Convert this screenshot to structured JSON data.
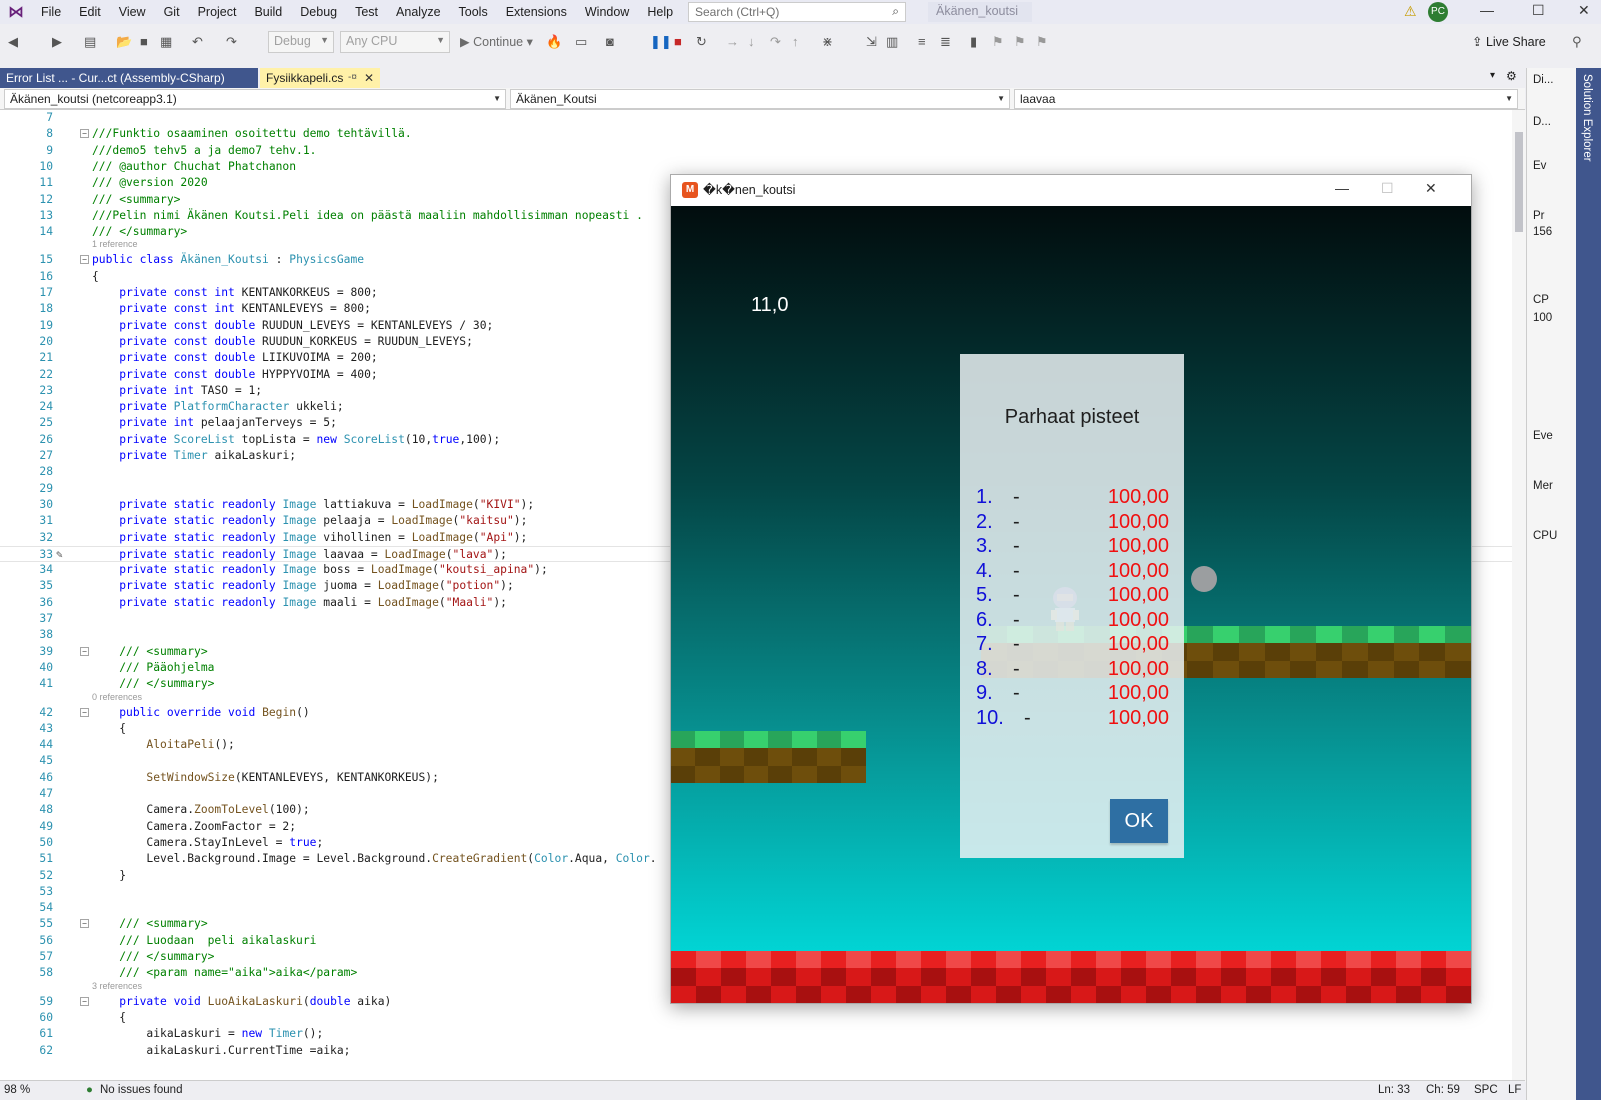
{
  "menubar": {
    "items": [
      "File",
      "Edit",
      "View",
      "Git",
      "Project",
      "Build",
      "Debug",
      "Test",
      "Analyze",
      "Tools",
      "Extensions",
      "Window",
      "Help"
    ],
    "search_placeholder": "Search (Ctrl+Q)",
    "solution_name": "Äkänen_koutsi",
    "avatar_initials": "PC"
  },
  "toolbar": {
    "config": "Debug",
    "platform": "Any CPU",
    "continue_label": "Continue",
    "live_share": "Live Share"
  },
  "tabs": {
    "error_list": "Error List ... - Cur...ct (Assembly-CSharp)",
    "file": "Fysiikkapeli.cs"
  },
  "navbar": {
    "project": "Äkänen_koutsi (netcoreapp3.1)",
    "class": "Äkänen_Koutsi",
    "member": "laavaa"
  },
  "code_lines": [
    {
      "n": "7",
      "html": ""
    },
    {
      "n": "8",
      "html": "<span class='cmt'>///Funktio osaaminen osoitettu demo tehtävillä.</span>",
      "fold": "−"
    },
    {
      "n": "9",
      "html": "<span class='cmt'>///demo5 tehv5 a ja demo7 tehv.1.</span>"
    },
    {
      "n": "10",
      "html": "<span class='cmt'>/// @author Chuchat Phatchanon</span>"
    },
    {
      "n": "11",
      "html": "<span class='cmt'>/// @version 2020</span>"
    },
    {
      "n": "12",
      "html": "<span class='cmt'>/// &lt;summary&gt;</span>"
    },
    {
      "n": "13",
      "html": "<span class='cmt'>///Pelin nimi Äkänen Koutsi.Peli idea on päästä maaliin mahdollisimman nopeasti .</span>"
    },
    {
      "n": "14",
      "html": "<span class='cmt'>/// &lt;/summary&gt;</span>",
      "ref": "1 reference"
    },
    {
      "n": "15",
      "html": "<span class='kw'>public class</span> <span class='ty'>Äkänen_Koutsi</span> : <span class='ty'>PhysicsGame</span>",
      "fold": "−"
    },
    {
      "n": "16",
      "html": "{"
    },
    {
      "n": "17",
      "html": "    <span class='kw'>private const int</span> KENTANKORKEUS = 800;"
    },
    {
      "n": "18",
      "html": "    <span class='kw'>private const int</span> KENTANLEVEYS = 800;"
    },
    {
      "n": "19",
      "html": "    <span class='kw'>private const double</span> RUUDUN_LEVEYS = KENTANLEVEYS / 30;"
    },
    {
      "n": "20",
      "html": "    <span class='kw'>private const double</span> RUUDUN_KORKEUS = RUUDUN_LEVEYS;"
    },
    {
      "n": "21",
      "html": "    <span class='kw'>private const double</span> LIIKUVOIMA = 200;"
    },
    {
      "n": "22",
      "html": "    <span class='kw'>private const double</span> HYPPYVOIMA = 400;"
    },
    {
      "n": "23",
      "html": "    <span class='kw'>private int</span> TASO = 1;"
    },
    {
      "n": "24",
      "html": "    <span class='kw'>private</span> <span class='ty'>PlatformCharacter</span> ukkeli;"
    },
    {
      "n": "25",
      "html": "    <span class='kw'>private int</span> pelaajanTerveys = 5;"
    },
    {
      "n": "26",
      "html": "    <span class='kw'>private</span> <span class='ty'>ScoreList</span> topLista = <span class='kw'>new</span> <span class='ty'>ScoreList</span>(10,<span class='kw'>true</span>,100);"
    },
    {
      "n": "27",
      "html": "    <span class='kw'>private</span> <span class='ty'>Timer</span> aikaLaskuri;"
    },
    {
      "n": "28",
      "html": ""
    },
    {
      "n": "29",
      "html": ""
    },
    {
      "n": "30",
      "html": "    <span class='kw'>private static readonly</span> <span class='ty'>Image</span> lattiakuva = <span class='mth'>LoadImage</span>(<span class='str'>\"KIVI\"</span>);"
    },
    {
      "n": "31",
      "html": "    <span class='kw'>private static readonly</span> <span class='ty'>Image</span> pelaaja = <span class='mth'>LoadImage</span>(<span class='str'>\"kaitsu\"</span>);"
    },
    {
      "n": "32",
      "html": "    <span class='kw'>private static readonly</span> <span class='ty'>Image</span> vihollinen = <span class='mth'>LoadImage</span>(<span class='str'>\"Api\"</span>);"
    },
    {
      "n": "33",
      "html": "    <span class='kw'>private static readonly</span> <span class='ty'>Image</span> laavaa = <span class='mth'>LoadImage</span>(<span class='str'>\"lava\"</span>);",
      "current": true
    },
    {
      "n": "34",
      "html": "    <span class='kw'>private static readonly</span> <span class='ty'>Image</span> boss = <span class='mth'>LoadImage</span>(<span class='str'>\"koutsi_apina\"</span>);"
    },
    {
      "n": "35",
      "html": "    <span class='kw'>private static readonly</span> <span class='ty'>Image</span> juoma = <span class='mth'>LoadImage</span>(<span class='str'>\"potion\"</span>);"
    },
    {
      "n": "36",
      "html": "    <span class='kw'>private static readonly</span> <span class='ty'>Image</span> maali = <span class='mth'>LoadImage</span>(<span class='str'>\"Maali\"</span>);"
    },
    {
      "n": "37",
      "html": ""
    },
    {
      "n": "38",
      "html": ""
    },
    {
      "n": "39",
      "html": "    <span class='cmt'>/// &lt;summary&gt;</span>",
      "fold": "−"
    },
    {
      "n": "40",
      "html": "    <span class='cmt'>/// Pääohjelma</span>"
    },
    {
      "n": "41",
      "html": "    <span class='cmt'>/// &lt;/summary&gt;</span>",
      "ref": "0 references"
    },
    {
      "n": "42",
      "html": "    <span class='kw'>public override void</span> <span class='mth'>Begin</span>()",
      "fold": "−"
    },
    {
      "n": "43",
      "html": "    {"
    },
    {
      "n": "44",
      "html": "        <span class='mth'>AloitaPeli</span>();"
    },
    {
      "n": "45",
      "html": ""
    },
    {
      "n": "46",
      "html": "        <span class='mth'>SetWindowSize</span>(KENTANLEVEYS, KENTANKORKEUS);"
    },
    {
      "n": "47",
      "html": ""
    },
    {
      "n": "48",
      "html": "        Camera.<span class='mth'>ZoomToLevel</span>(100);"
    },
    {
      "n": "49",
      "html": "        Camera.ZoomFactor = 2;"
    },
    {
      "n": "50",
      "html": "        Camera.StayInLevel = <span class='kw'>true</span>;"
    },
    {
      "n": "51",
      "html": "        Level.Background.Image = Level.Background.<span class='mth'>CreateGradient</span>(<span class='ty'>Color</span>.Aqua, <span class='ty'>Color</span>."
    },
    {
      "n": "52",
      "html": "    }"
    },
    {
      "n": "53",
      "html": ""
    },
    {
      "n": "54",
      "html": ""
    },
    {
      "n": "55",
      "html": "    <span class='cmt'>/// &lt;summary&gt;</span>",
      "fold": "−"
    },
    {
      "n": "56",
      "html": "    <span class='cmt'>/// Luodaan  peli aikalaskuri</span>"
    },
    {
      "n": "57",
      "html": "    <span class='cmt'>/// &lt;/summary&gt;</span>"
    },
    {
      "n": "58",
      "html": "    <span class='cmt'>/// &lt;param name=\"aika\"&gt;aika&lt;/param&gt;</span>",
      "ref": "3 references"
    },
    {
      "n": "59",
      "html": "    <span class='kw'>private void</span> <span class='mth'>LuoAikaLaskuri</span>(<span class='kw'>double</span> aika)",
      "fold": "−"
    },
    {
      "n": "60",
      "html": "    {"
    },
    {
      "n": "61",
      "html": "        aikaLaskuri = <span class='kw'>new</span> <span class='ty'>Timer</span>();"
    },
    {
      "n": "62",
      "html": "        aikaLaskuri.CurrentTime =aika;"
    }
  ],
  "statusbar": {
    "zoom": "98 %",
    "issues": "No issues found",
    "ln": "Ln: 33",
    "ch": "Ch: 59",
    "spc": "SPC",
    "lf": "LF"
  },
  "right_panel": {
    "items": [
      "Di...",
      "D...",
      "Ev",
      "Pr",
      "156",
      "CP",
      "100",
      "Eve",
      "Mer",
      "CPU"
    ],
    "solution_explorer": "Solution Explorer"
  },
  "game": {
    "window_title": "�k�nen_koutsi",
    "timer": "11,0",
    "highscore_title": "Parhaat pisteet",
    "scores": [
      {
        "rank": "1.",
        "name": "-",
        "score": "100,00"
      },
      {
        "rank": "2.",
        "name": "-",
        "score": "100,00"
      },
      {
        "rank": "3.",
        "name": "-",
        "score": "100,00"
      },
      {
        "rank": "4.",
        "name": "-",
        "score": "100,00"
      },
      {
        "rank": "5.",
        "name": "-",
        "score": "100,00"
      },
      {
        "rank": "6.",
        "name": "-",
        "score": "100,00"
      },
      {
        "rank": "7.",
        "name": "-",
        "score": "100,00"
      },
      {
        "rank": "8.",
        "name": "-",
        "score": "100,00"
      },
      {
        "rank": "9.",
        "name": "-",
        "score": "100,00"
      },
      {
        "rank": "10.",
        "name": "-",
        "score": "100,00"
      }
    ],
    "ok_label": "OK",
    "colors": {
      "rank": "#1010d8",
      "score": "#f01010",
      "ok_button": "#2e6fa3"
    }
  }
}
